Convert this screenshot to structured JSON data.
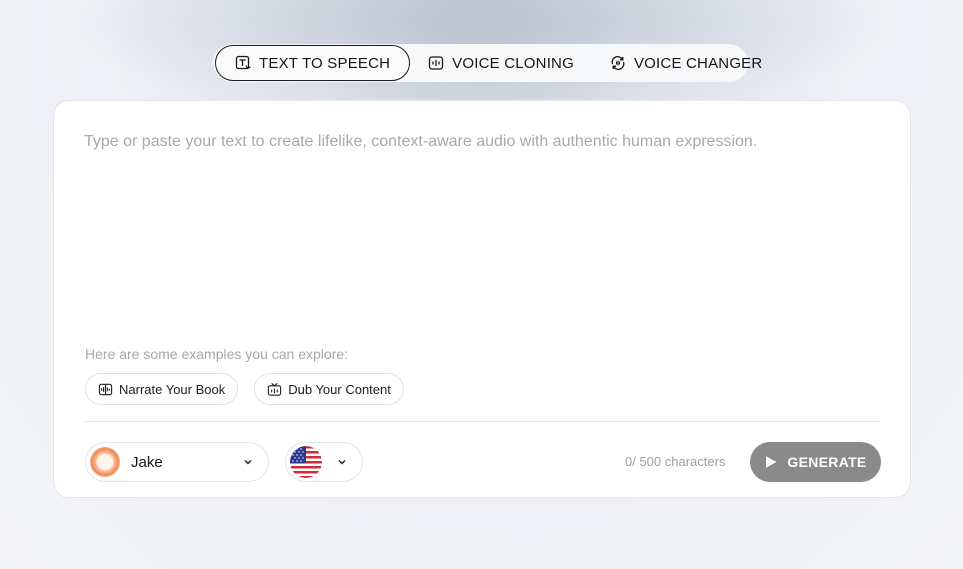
{
  "tabs": [
    {
      "label": "TEXT TO SPEECH",
      "icon": "text-to-speech-icon",
      "active": true
    },
    {
      "label": "VOICE CLONING",
      "icon": "voice-cloning-icon",
      "active": false
    },
    {
      "label": "VOICE CHANGER",
      "icon": "voice-changer-icon",
      "active": false
    }
  ],
  "editor": {
    "placeholder": "Type or paste your text to create lifelike, context-aware audio with authentic human expression.",
    "value": ""
  },
  "examples": {
    "label": "Here are some examples you can explore:",
    "items": [
      {
        "label": "Narrate Your Book",
        "icon": "book-audio-icon"
      },
      {
        "label": "Dub Your Content",
        "icon": "dub-content-icon"
      }
    ]
  },
  "voice": {
    "selected": "Jake",
    "avatar_icon": "orange-ring-avatar"
  },
  "language": {
    "flag_icon": "us-flag-icon"
  },
  "char_count": "0/ 500 characters",
  "generate": {
    "label": "GENERATE",
    "color": "#8a8a8a"
  }
}
